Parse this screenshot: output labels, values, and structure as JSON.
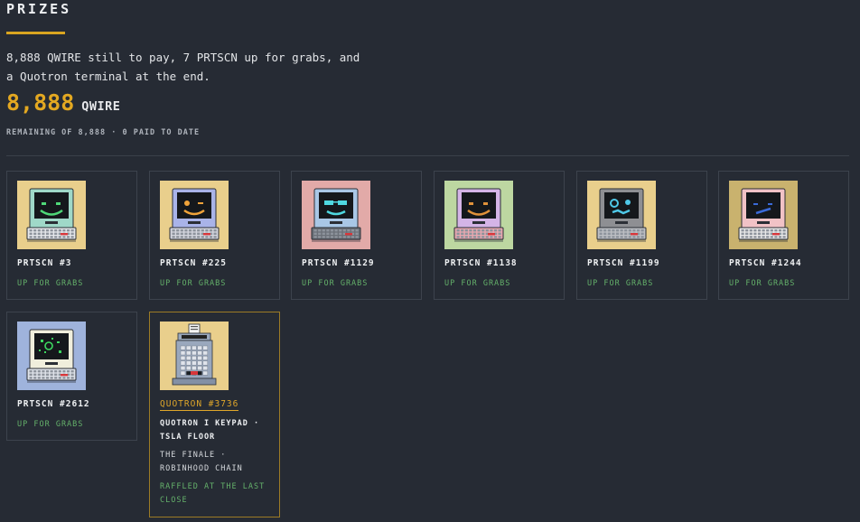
{
  "header": {
    "title": "PRIZES",
    "intro": "8,888 QWIRE still to pay, 7 PRTSCN up for grabs, and a Quotron terminal at the end.",
    "amount": "8,888",
    "unit": "QWIRE",
    "subline": "REMAINING OF 8,888 · 0 PAID TO DATE"
  },
  "prizes": [
    {
      "name": "PRTSCN #3",
      "status": "UP FOR GRABS",
      "bg": "#e9cf8c",
      "monitor": "#9fd8c8",
      "keys": "#e6e8ec",
      "face": "#4fd878",
      "face_type": "grin"
    },
    {
      "name": "PRTSCN #225",
      "status": "UP FOR GRABS",
      "bg": "#e9cf8c",
      "monitor": "#a9b3e8",
      "keys": "#d4d6de",
      "face": "#f0a33a",
      "face_type": "wink"
    },
    {
      "name": "PRTSCN #1129",
      "status": "UP FOR GRABS",
      "bg": "#e2aaa8",
      "monitor": "#a9c7e6",
      "keys": "#6b7078",
      "face": "#4fd8e0",
      "face_type": "shades"
    },
    {
      "name": "PRTSCN #1138",
      "status": "UP FOR GRABS",
      "bg": "#bdd7a1",
      "monitor": "#d4b4e6",
      "keys": "#e9a8b0",
      "face": "#e0923a",
      "face_type": "grin"
    },
    {
      "name": "PRTSCN #1199",
      "status": "UP FOR GRABS",
      "bg": "#e9cf8c",
      "monitor": "#8e8f93",
      "keys": "#bdbfc4",
      "face": "#4fc8e8",
      "face_type": "crazy"
    },
    {
      "name": "PRTSCN #1244",
      "status": "UP FOR GRABS",
      "bg": "#c9b26e",
      "monitor": "#f1c2c6",
      "keys": "#e8e8e8",
      "face": "#3a6ad8",
      "face_type": "sad"
    },
    {
      "name": "PRTSCN #2612",
      "status": "UP FOR GRABS",
      "bg": "#9fb3dc",
      "monitor": "#f0eedc",
      "keys": "#dfe3ea",
      "face": "#3cd860",
      "face_type": "glitch"
    }
  ],
  "finale": {
    "name": "QUOTRON #3736",
    "desc": "QUOTRON I KEYPAD · TSLA FLOOR",
    "desc2": "THE FINALE · ROBINHOOD CHAIN",
    "status": "RAFFLED AT THE LAST CLOSE",
    "bg": "#e9cf8c"
  }
}
